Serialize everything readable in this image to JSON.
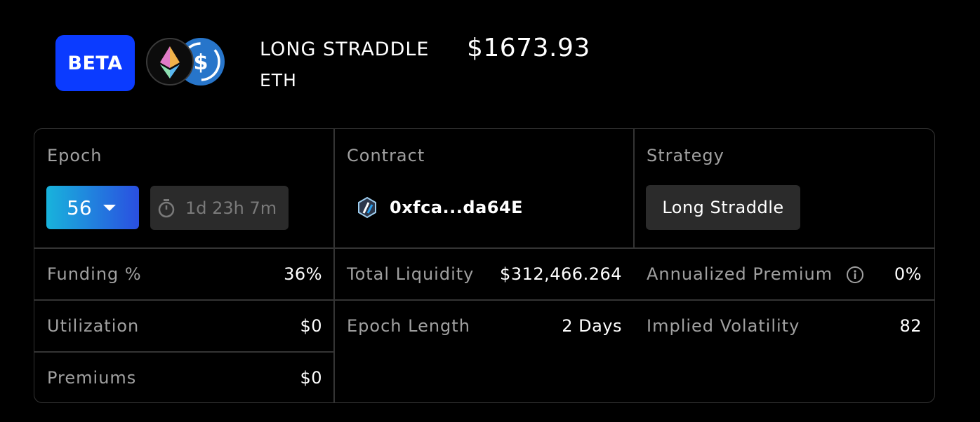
{
  "header": {
    "badge": "BETA",
    "title": "LONG STRADDLE",
    "asset": "ETH",
    "price": "$1673.93",
    "tokens": [
      "eth-icon",
      "usdc-icon"
    ]
  },
  "panel": {
    "epoch": {
      "label": "Epoch",
      "selected": "56",
      "timer": "1d 23h 7m"
    },
    "contract": {
      "label": "Contract",
      "address": "0xfca...da64E"
    },
    "strategy": {
      "label": "Strategy",
      "value": "Long Straddle"
    },
    "stats": {
      "funding": {
        "label": "Funding %",
        "value": "36%"
      },
      "total_liquidity": {
        "label": "Total Liquidity",
        "value": "$312,466.264"
      },
      "annualized_premium": {
        "label": "Annualized Premium",
        "value": "0%"
      },
      "utilization": {
        "label": "Utilization",
        "value": "$0"
      },
      "epoch_length": {
        "label": "Epoch Length",
        "value": "2 Days"
      },
      "implied_volatility": {
        "label": "Implied Volatility",
        "value": "82"
      },
      "premiums": {
        "label": "Premiums",
        "value": "$0"
      }
    }
  },
  "colors": {
    "background": "#000000",
    "beta": "#0b3bff",
    "border": "#343434",
    "label": "#a0a0a0",
    "pill": "#2b2b2b",
    "usdc": "#2775ca"
  }
}
